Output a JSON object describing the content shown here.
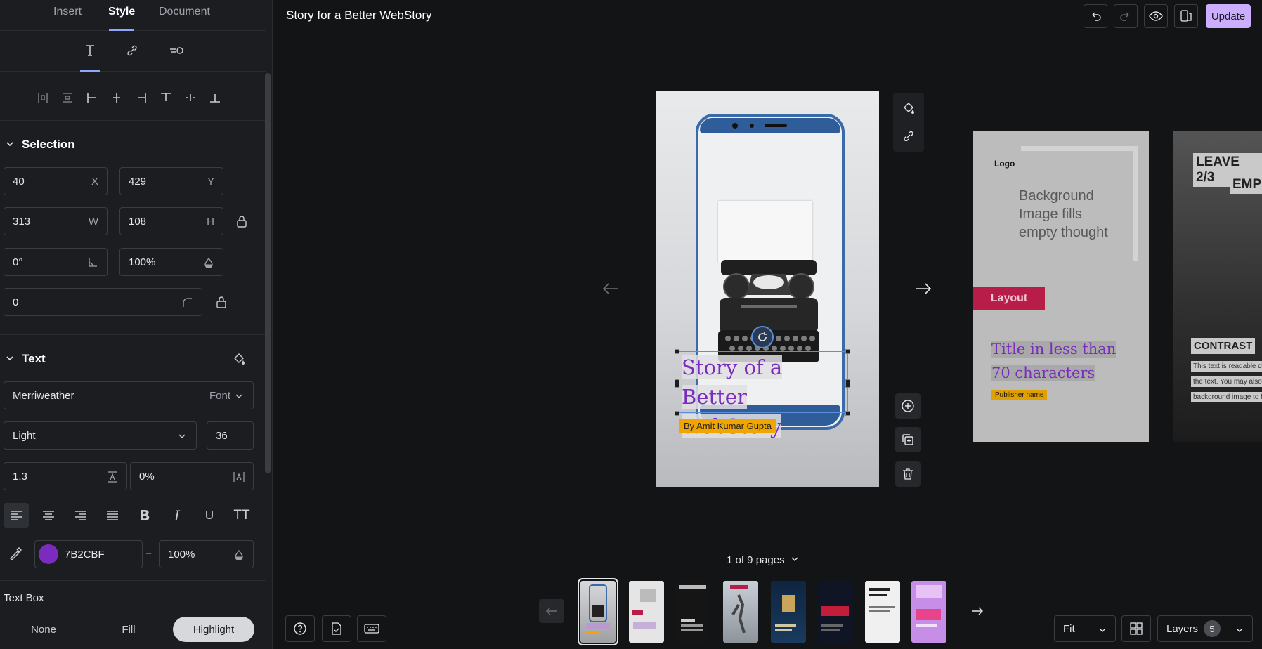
{
  "tabs": [
    {
      "label": "Insert"
    },
    {
      "label": "Style"
    },
    {
      "label": "Document"
    }
  ],
  "selection": {
    "heading": "Selection",
    "x": "40",
    "x_label": "X",
    "y": "429",
    "y_label": "Y",
    "w": "313",
    "w_label": "W",
    "h": "108",
    "h_label": "H",
    "dash": "–",
    "rotation": "0°",
    "opacity": "100%",
    "radius": "0"
  },
  "text": {
    "heading": "Text",
    "font": "Merriweather",
    "font_label": "Font",
    "weight": "Light",
    "size": "36",
    "line_height": "1.3",
    "letter_spacing": "0%",
    "bold": "B",
    "italic": "I",
    "underline": "U",
    "uppercase": "TT",
    "color_hex": "7B2CBF",
    "color_value": "#7B2CBF",
    "color_dash": "–",
    "color_opacity": "100%"
  },
  "text_box": {
    "label": "Text Box",
    "options": [
      {
        "label": "None"
      },
      {
        "label": "Fill"
      },
      {
        "label": "Highlight"
      }
    ]
  },
  "header": {
    "title": "Story for a Better WebStory",
    "update_label": "Update"
  },
  "canvas": {
    "title_line1": "Story of a Better",
    "title_line2": "WebStory",
    "byline": "By Amit Kumar Gupta"
  },
  "page2": {
    "logo": "Logo",
    "bg_text": "Background Image fills empty thought",
    "layout": "Layout",
    "title_line1": "Title in less than",
    "title_line2": "70 characters",
    "publisher": "Publisher name"
  },
  "page3": {
    "leave": "LEAVE 2/3",
    "emp": "EMP",
    "contrast": "CONTRAST",
    "line1": "This text is readable due",
    "line2": "the text. You may also ap",
    "line3": "background image to hig"
  },
  "footer": {
    "pages_count": "1 of 9 pages",
    "zoom": "Fit",
    "layers_label": "Layers",
    "layers_count": "5"
  },
  "colors": {
    "accent": "#8ea7ff",
    "update_bg": "#cbaeff",
    "text_color": "#7B2CBF",
    "byline_bg": "#f0a500",
    "layout_red": "#b81d4a"
  }
}
